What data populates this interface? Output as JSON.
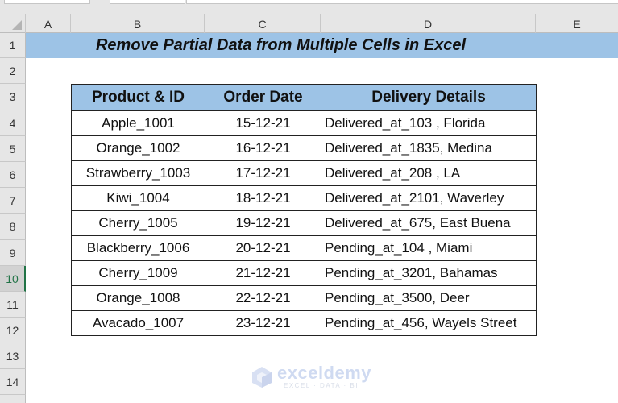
{
  "window": {
    "toolbar_fragments": [
      "name-box",
      "formula-controls",
      "formula-bar"
    ]
  },
  "sheet": {
    "columns": [
      "A",
      "B",
      "C",
      "D",
      "E"
    ],
    "rows": [
      "1",
      "2",
      "3",
      "4",
      "5",
      "6",
      "7",
      "8",
      "9",
      "10",
      "11",
      "12",
      "13",
      "14"
    ],
    "selected_row": "10",
    "title": "Remove Partial Data from Multiple Cells in Excel",
    "accent_color": "#9dc3e6",
    "selection_color": "#217346"
  },
  "table": {
    "headers": [
      "Product & ID",
      "Order Date",
      "Delivery Details"
    ],
    "rows": [
      [
        "Apple_1001",
        "15-12-21",
        "Delivered_at_103 , Florida"
      ],
      [
        "Orange_1002",
        "16-12-21",
        "Delivered_at_1835, Medina"
      ],
      [
        "Strawberry_1003",
        "17-12-21",
        "Delivered_at_208 , LA"
      ],
      [
        "Kiwi_1004",
        "18-12-21",
        "Delivered_at_2101, Waverley"
      ],
      [
        "Cherry_1005",
        "19-12-21",
        "Delivered_at_675, East Buena"
      ],
      [
        "Blackberry_1006",
        "20-12-21",
        "Pending_at_104 , Miami"
      ],
      [
        "Cherry_1009",
        "21-12-21",
        "Pending_at_3201, Bahamas"
      ],
      [
        "Orange_1008",
        "22-12-21",
        "Pending_at_3500, Deer"
      ],
      [
        "Avacado_1007",
        "23-12-21",
        "Pending_at_456, Wayels Street"
      ]
    ]
  },
  "watermark": {
    "name": "exceldemy",
    "tagline": "EXCEL · DATA · BI",
    "icon": "exceldemy-logo-icon"
  }
}
